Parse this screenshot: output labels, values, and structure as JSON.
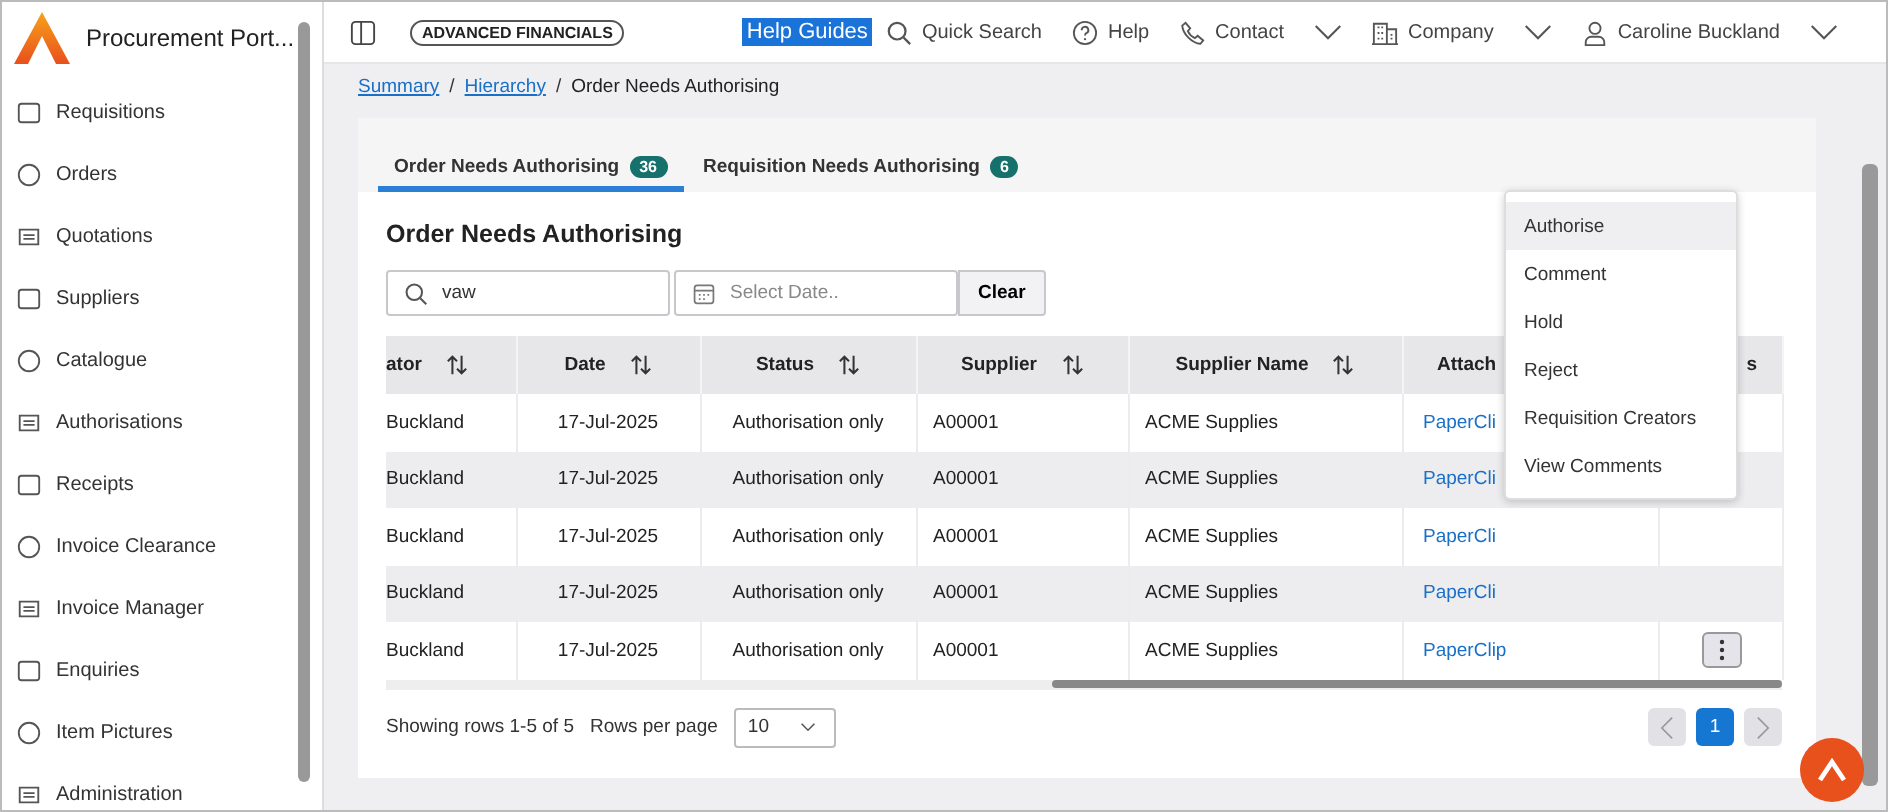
{
  "app": {
    "title": "Procurement Port..."
  },
  "sidebar": {
    "items": [
      {
        "label": "Requisitions"
      },
      {
        "label": "Orders"
      },
      {
        "label": "Quotations"
      },
      {
        "label": "Suppliers"
      },
      {
        "label": "Catalogue"
      },
      {
        "label": "Authorisations"
      },
      {
        "label": "Receipts"
      },
      {
        "label": "Invoice Clearance"
      },
      {
        "label": "Invoice Manager"
      },
      {
        "label": "Enquiries"
      },
      {
        "label": "Item Pictures"
      },
      {
        "label": "Administration"
      }
    ]
  },
  "topbar": {
    "badge": "ADVANCED FINANCIALS",
    "help_guides": "Help Guides",
    "quick_search": "Quick Search",
    "help": "Help",
    "contact": "Contact",
    "company": "Company",
    "user": "Caroline Buckland"
  },
  "breadcrumb": {
    "links": [
      "Summary",
      "Hierarchy"
    ],
    "separators": [
      "/",
      "/"
    ],
    "current": "Order Needs Authorising"
  },
  "tabs": [
    {
      "label": "Order Needs Authorising",
      "count": "36",
      "selected": true
    },
    {
      "label": "Requisition Needs Authorising",
      "count": "6",
      "selected": false
    }
  ],
  "panel": {
    "title": "Order Needs Authorising",
    "search": {
      "value": "vaw"
    },
    "date": {
      "placeholder": "Select Date.."
    },
    "clear": "Clear"
  },
  "table": {
    "columns": [
      {
        "label": "ator",
        "sortable": true
      },
      {
        "label": "Date",
        "sortable": true
      },
      {
        "label": "Status",
        "sortable": true
      },
      {
        "label": "Supplier",
        "sortable": true
      },
      {
        "label": "Supplier Name",
        "sortable": true
      },
      {
        "label": "Attach"
      },
      {
        "label": "s"
      }
    ],
    "rows": [
      {
        "cells": [
          "Buckland",
          "17-Jul-2025",
          "Authorisation only",
          "A00001",
          "ACME Supplies",
          "PaperCli"
        ],
        "actions": false
      },
      {
        "cells": [
          "Buckland",
          "17-Jul-2025",
          "Authorisation only",
          "A00001",
          "ACME Supplies",
          "PaperCli"
        ],
        "actions": false
      },
      {
        "cells": [
          "Buckland",
          "17-Jul-2025",
          "Authorisation only",
          "A00001",
          "ACME Supplies",
          "PaperCli"
        ],
        "actions": false
      },
      {
        "cells": [
          "Buckland",
          "17-Jul-2025",
          "Authorisation only",
          "A00001",
          "ACME Supplies",
          "PaperCli"
        ],
        "actions": false
      },
      {
        "cells": [
          "Buckland",
          "17-Jul-2025",
          "Authorisation only",
          "A00001",
          "ACME Supplies",
          "PaperClip"
        ],
        "actions": true
      }
    ]
  },
  "menu": {
    "items": [
      {
        "label": "Authorise",
        "selected": true
      },
      {
        "label": "Comment",
        "selected": false
      },
      {
        "label": "Hold",
        "selected": false
      },
      {
        "label": "Reject",
        "selected": false
      },
      {
        "label": "Requisition Creators",
        "selected": false
      },
      {
        "label": "View Comments",
        "selected": false
      }
    ]
  },
  "footer": {
    "showing": "Showing rows 1-5 of 5",
    "rows_per_page": "Rows per page",
    "page_size": "10",
    "pages": [
      {
        "label": "1",
        "selected": true
      }
    ]
  }
}
